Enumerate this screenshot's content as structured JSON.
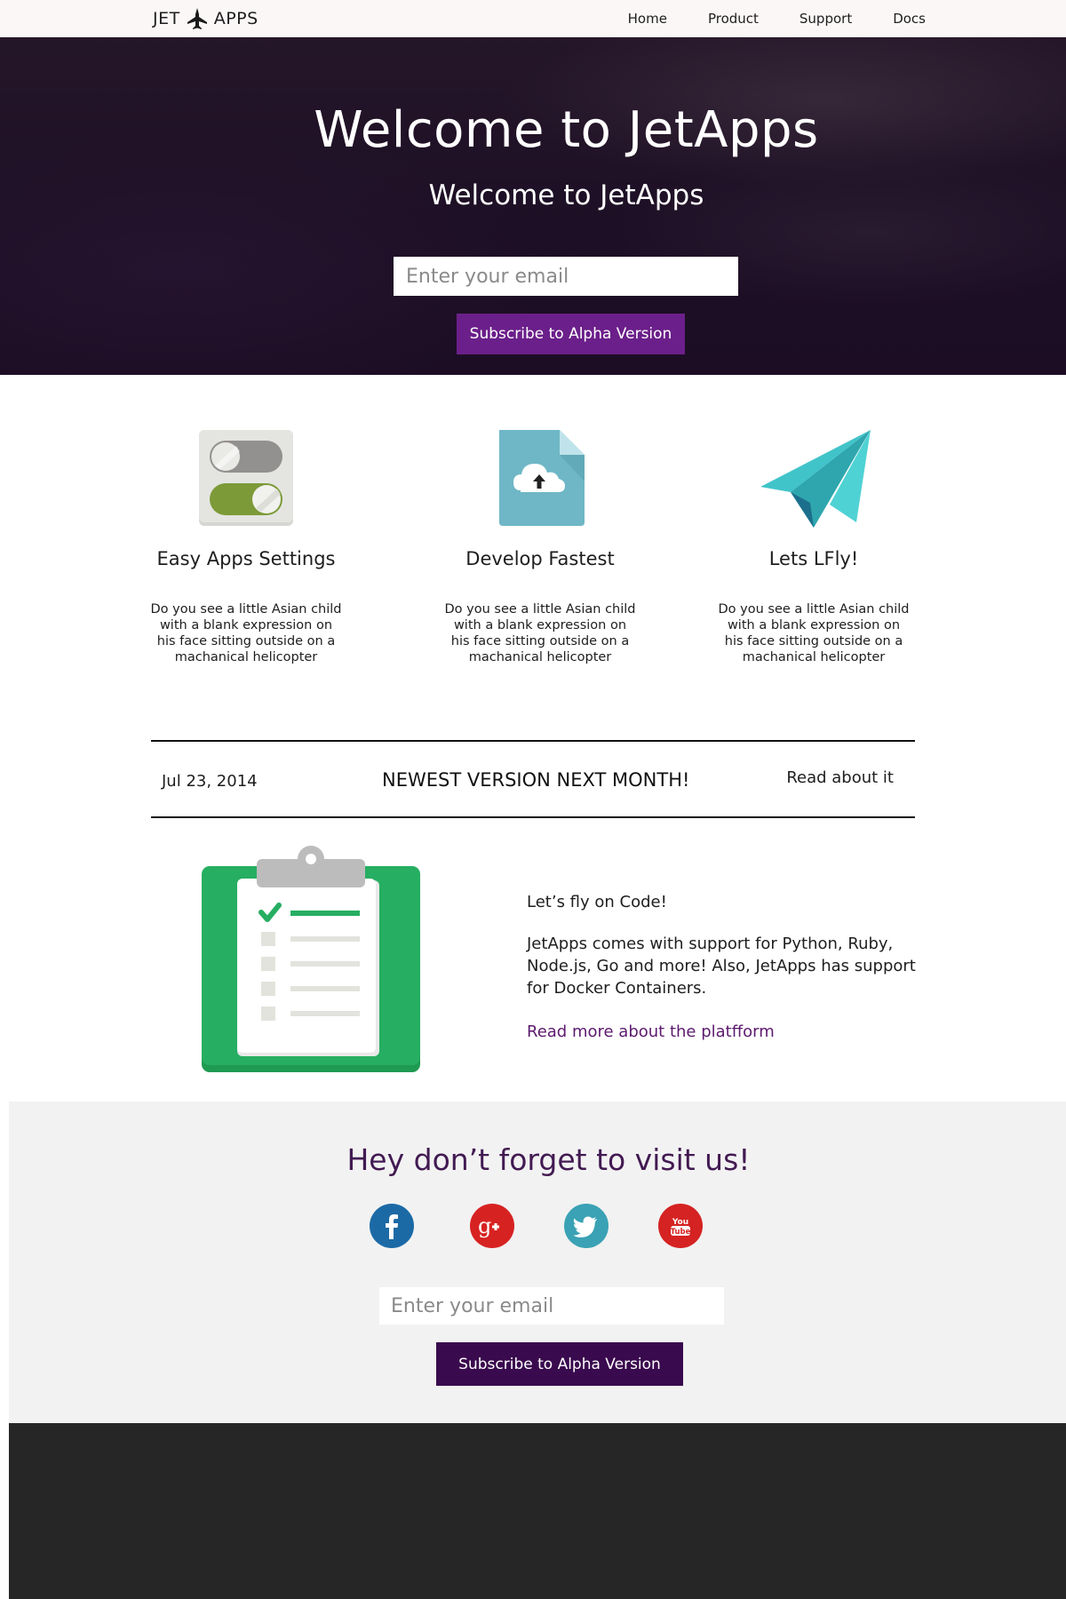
{
  "nav": {
    "logo_left": "JET",
    "logo_right": "APPS",
    "logo_icon": "jet-plane-icon",
    "links": [
      "Home",
      "Product",
      "Support",
      "Docs"
    ]
  },
  "hero": {
    "title": "Welcome to JetApps",
    "subtitle": "Welcome to JetApps",
    "email_placeholder": "Enter your email",
    "subscribe_label": "Subscribe to Alpha Version"
  },
  "features": [
    {
      "icon": "toggle-settings-icon",
      "title": "Easy Apps Settings",
      "text": "Do you see a little Asian child with a blank expression on his face sitting outside on a machanical helicopter"
    },
    {
      "icon": "cloud-upload-file-icon",
      "title": "Develop Fastest",
      "text": "Do you see a little Asian child with a blank expression on his face sitting outside on a machanical helicopter"
    },
    {
      "icon": "paper-plane-icon",
      "title": "Lets LFly!",
      "text": "Do you see a little Asian child with a blank expression on his face sitting outside on a machanical helicopter"
    }
  ],
  "news": {
    "date": "Jul 23, 2014",
    "headline": "NEWEST VERSION NEXT MONTH!",
    "link": "Read about it"
  },
  "code_section": {
    "icon": "clipboard-checklist-icon",
    "intro": "Let’s fly on Code!",
    "description": "JetApps comes with support for Python, Ruby, Node.js, Go and more! Also, JetApps has support for Docker Containers.",
    "link": "Read more about the platfform"
  },
  "visit": {
    "title": "Hey don’t forget to visit us!",
    "socials": [
      {
        "name": "facebook-icon",
        "glyph": "f",
        "color": "#1b6aa6"
      },
      {
        "name": "google-plus-icon",
        "glyph": "g+",
        "color": "#d72222"
      },
      {
        "name": "twitter-icon",
        "glyph": "",
        "color": "#3aa2b4"
      },
      {
        "name": "youtube-icon",
        "glyph": "You Tube",
        "color": "#d52222"
      }
    ],
    "email_placeholder": "Enter your email",
    "subscribe_label": "Subscribe to Alpha Version"
  },
  "colors": {
    "hero_button": "#6b1f8a",
    "visit_button": "#3a0a4e",
    "visit_title": "#421a52",
    "link": "#5c1a6e",
    "footer": "#262626"
  }
}
